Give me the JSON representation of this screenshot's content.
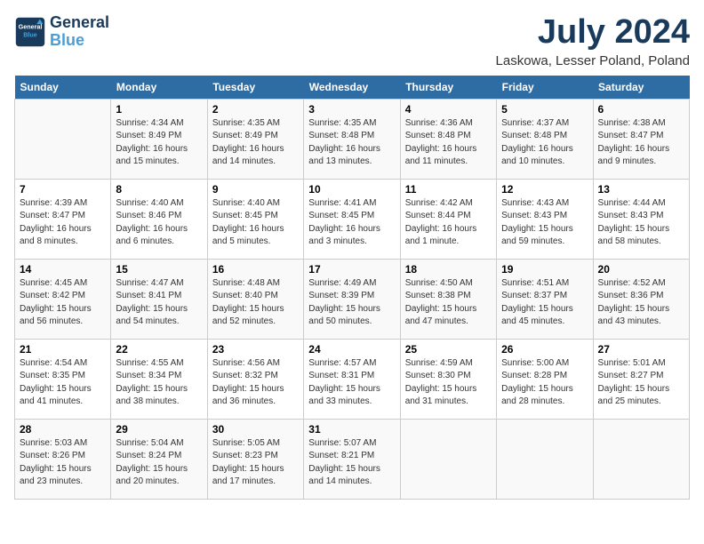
{
  "header": {
    "logo_line1": "General",
    "logo_line2": "Blue",
    "month": "July 2024",
    "location": "Laskowa, Lesser Poland, Poland"
  },
  "days_of_week": [
    "Sunday",
    "Monday",
    "Tuesday",
    "Wednesday",
    "Thursday",
    "Friday",
    "Saturday"
  ],
  "weeks": [
    [
      {
        "day": "",
        "info": ""
      },
      {
        "day": "1",
        "info": "Sunrise: 4:34 AM\nSunset: 8:49 PM\nDaylight: 16 hours and 15 minutes."
      },
      {
        "day": "2",
        "info": "Sunrise: 4:35 AM\nSunset: 8:49 PM\nDaylight: 16 hours and 14 minutes."
      },
      {
        "day": "3",
        "info": "Sunrise: 4:35 AM\nSunset: 8:48 PM\nDaylight: 16 hours and 13 minutes."
      },
      {
        "day": "4",
        "info": "Sunrise: 4:36 AM\nSunset: 8:48 PM\nDaylight: 16 hours and 11 minutes."
      },
      {
        "day": "5",
        "info": "Sunrise: 4:37 AM\nSunset: 8:48 PM\nDaylight: 16 hours and 10 minutes."
      },
      {
        "day": "6",
        "info": "Sunrise: 4:38 AM\nSunset: 8:47 PM\nDaylight: 16 hours and 9 minutes."
      }
    ],
    [
      {
        "day": "7",
        "info": "Sunrise: 4:39 AM\nSunset: 8:47 PM\nDaylight: 16 hours and 8 minutes."
      },
      {
        "day": "8",
        "info": "Sunrise: 4:40 AM\nSunset: 8:46 PM\nDaylight: 16 hours and 6 minutes."
      },
      {
        "day": "9",
        "info": "Sunrise: 4:40 AM\nSunset: 8:45 PM\nDaylight: 16 hours and 5 minutes."
      },
      {
        "day": "10",
        "info": "Sunrise: 4:41 AM\nSunset: 8:45 PM\nDaylight: 16 hours and 3 minutes."
      },
      {
        "day": "11",
        "info": "Sunrise: 4:42 AM\nSunset: 8:44 PM\nDaylight: 16 hours and 1 minute."
      },
      {
        "day": "12",
        "info": "Sunrise: 4:43 AM\nSunset: 8:43 PM\nDaylight: 15 hours and 59 minutes."
      },
      {
        "day": "13",
        "info": "Sunrise: 4:44 AM\nSunset: 8:43 PM\nDaylight: 15 hours and 58 minutes."
      }
    ],
    [
      {
        "day": "14",
        "info": "Sunrise: 4:45 AM\nSunset: 8:42 PM\nDaylight: 15 hours and 56 minutes."
      },
      {
        "day": "15",
        "info": "Sunrise: 4:47 AM\nSunset: 8:41 PM\nDaylight: 15 hours and 54 minutes."
      },
      {
        "day": "16",
        "info": "Sunrise: 4:48 AM\nSunset: 8:40 PM\nDaylight: 15 hours and 52 minutes."
      },
      {
        "day": "17",
        "info": "Sunrise: 4:49 AM\nSunset: 8:39 PM\nDaylight: 15 hours and 50 minutes."
      },
      {
        "day": "18",
        "info": "Sunrise: 4:50 AM\nSunset: 8:38 PM\nDaylight: 15 hours and 47 minutes."
      },
      {
        "day": "19",
        "info": "Sunrise: 4:51 AM\nSunset: 8:37 PM\nDaylight: 15 hours and 45 minutes."
      },
      {
        "day": "20",
        "info": "Sunrise: 4:52 AM\nSunset: 8:36 PM\nDaylight: 15 hours and 43 minutes."
      }
    ],
    [
      {
        "day": "21",
        "info": "Sunrise: 4:54 AM\nSunset: 8:35 PM\nDaylight: 15 hours and 41 minutes."
      },
      {
        "day": "22",
        "info": "Sunrise: 4:55 AM\nSunset: 8:34 PM\nDaylight: 15 hours and 38 minutes."
      },
      {
        "day": "23",
        "info": "Sunrise: 4:56 AM\nSunset: 8:32 PM\nDaylight: 15 hours and 36 minutes."
      },
      {
        "day": "24",
        "info": "Sunrise: 4:57 AM\nSunset: 8:31 PM\nDaylight: 15 hours and 33 minutes."
      },
      {
        "day": "25",
        "info": "Sunrise: 4:59 AM\nSunset: 8:30 PM\nDaylight: 15 hours and 31 minutes."
      },
      {
        "day": "26",
        "info": "Sunrise: 5:00 AM\nSunset: 8:28 PM\nDaylight: 15 hours and 28 minutes."
      },
      {
        "day": "27",
        "info": "Sunrise: 5:01 AM\nSunset: 8:27 PM\nDaylight: 15 hours and 25 minutes."
      }
    ],
    [
      {
        "day": "28",
        "info": "Sunrise: 5:03 AM\nSunset: 8:26 PM\nDaylight: 15 hours and 23 minutes."
      },
      {
        "day": "29",
        "info": "Sunrise: 5:04 AM\nSunset: 8:24 PM\nDaylight: 15 hours and 20 minutes."
      },
      {
        "day": "30",
        "info": "Sunrise: 5:05 AM\nSunset: 8:23 PM\nDaylight: 15 hours and 17 minutes."
      },
      {
        "day": "31",
        "info": "Sunrise: 5:07 AM\nSunset: 8:21 PM\nDaylight: 15 hours and 14 minutes."
      },
      {
        "day": "",
        "info": ""
      },
      {
        "day": "",
        "info": ""
      },
      {
        "day": "",
        "info": ""
      }
    ]
  ]
}
